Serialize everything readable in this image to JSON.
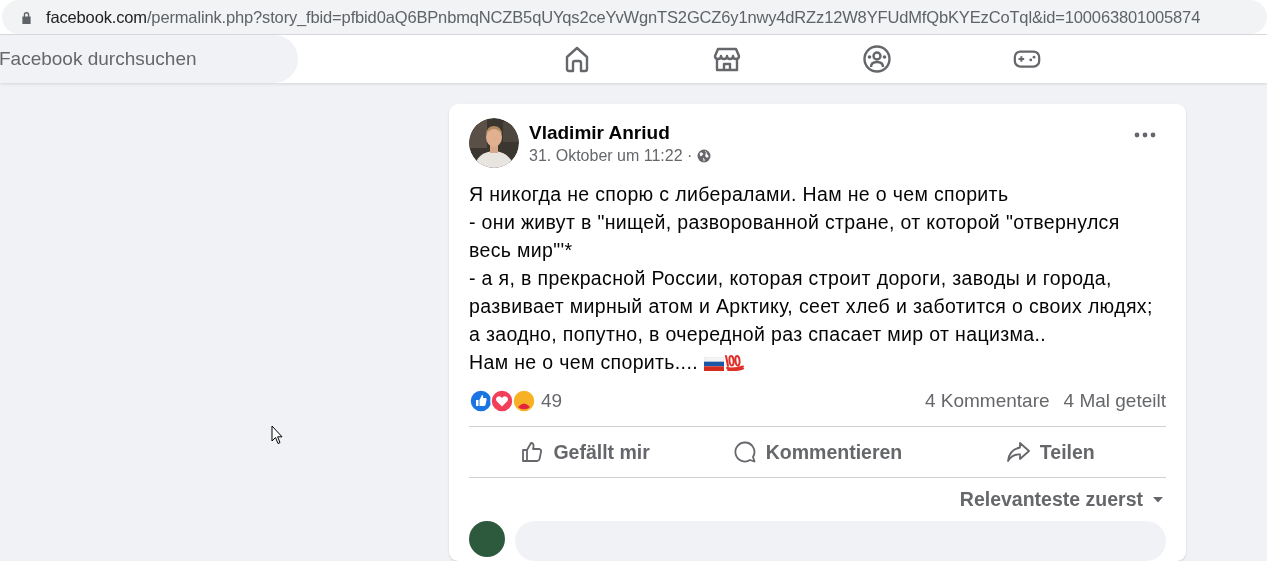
{
  "address_bar": {
    "domain": "facebook.com",
    "path": "/permalink.php?story_fbid=pfbid0aQ6BPnbmqNCZB5qUYqs2ceYvWgnTS2GCZ6y1nwy4dRZz12W8YFUdMfQbKYEzCoTql&id=100063801005874"
  },
  "search": {
    "placeholder": "Facebook durchsuchen"
  },
  "nav_tabs": [
    {
      "kind": "home"
    },
    {
      "kind": "store"
    },
    {
      "kind": "groups"
    },
    {
      "kind": "gaming"
    }
  ],
  "post": {
    "author": "Vladimir Anriud",
    "time": "31. Oktober um 11:22 ·",
    "lines": [
      "Я никогда не спорю с либералами. Нам не о чем спорить",
      "- они живут в \"нищей, разворованной стране, от которой \"отвернулся весь мир\"'*",
      "- а я, в прекрасной России, которая строит дороги, заводы и города, развивает мирный атом и Арктику, сеет хлеб и заботится о своих людях; а заодно, попутно, в очередной раз спасает мир от нацизма..",
      "Нам не о чем спорить...."
    ],
    "reaction_count": "49",
    "comments": "4 Kommentare",
    "shares": "4 Mal geteilt",
    "actions": [
      {
        "kind": "like",
        "label": "Gefällt mir"
      },
      {
        "kind": "comment",
        "label": "Kommentieren"
      },
      {
        "kind": "share",
        "label": "Teilen"
      }
    ],
    "sort": "Relevanteste zuerst"
  }
}
